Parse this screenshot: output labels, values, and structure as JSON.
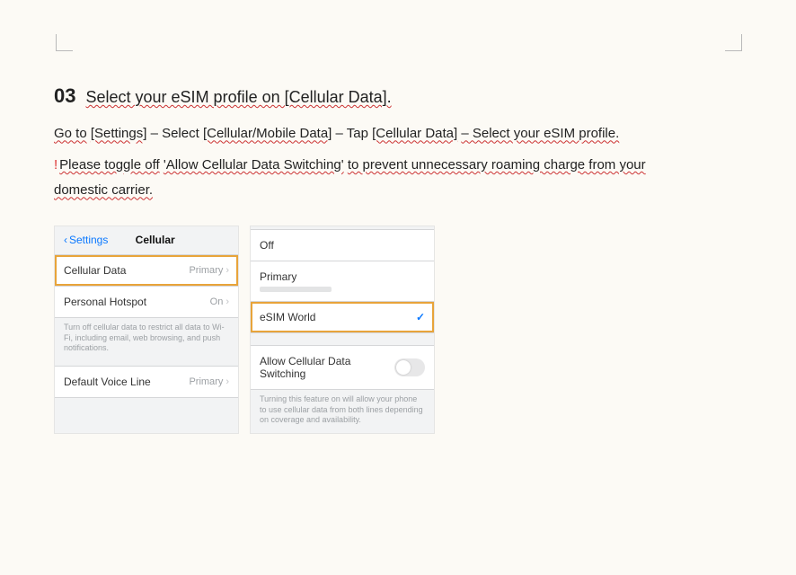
{
  "step": {
    "number": "03",
    "title": "Select your eSIM profile on [Cellular Data]."
  },
  "instr1": {
    "t1": "Go to",
    "t2": "[Settings]",
    "t3": "– Select",
    "t4": "[Cellular/Mobile Data]",
    "t5": "– Tap",
    "t6": "[Cellular Data]",
    "t7": "– Select your eSIM profile."
  },
  "instr2": {
    "marker": "!",
    "t1": "Please toggle off",
    "q": "'Allow Cellular Data Switching'",
    "t2": "to prevent unnecessary roaming charge from your",
    "t3": "domestic carrier."
  },
  "left": {
    "back": "Settings",
    "title": "Cellular",
    "rows": {
      "cellular_data": {
        "label": "Cellular Data",
        "value": "Primary"
      },
      "hotspot": {
        "label": "Personal Hotspot",
        "value": "On"
      },
      "note": "Turn off cellular data to restrict all data to Wi-Fi, including email, web browsing, and push notifications.",
      "voice": {
        "label": "Default Voice Line",
        "value": "Primary"
      }
    }
  },
  "right": {
    "rows": {
      "off": "Off",
      "primary": "Primary",
      "esim": "eSIM World",
      "allow": "Allow Cellular Data Switching"
    },
    "note": "Turning this feature on will allow your phone to use cellular data from both lines depending on coverage and availability."
  }
}
